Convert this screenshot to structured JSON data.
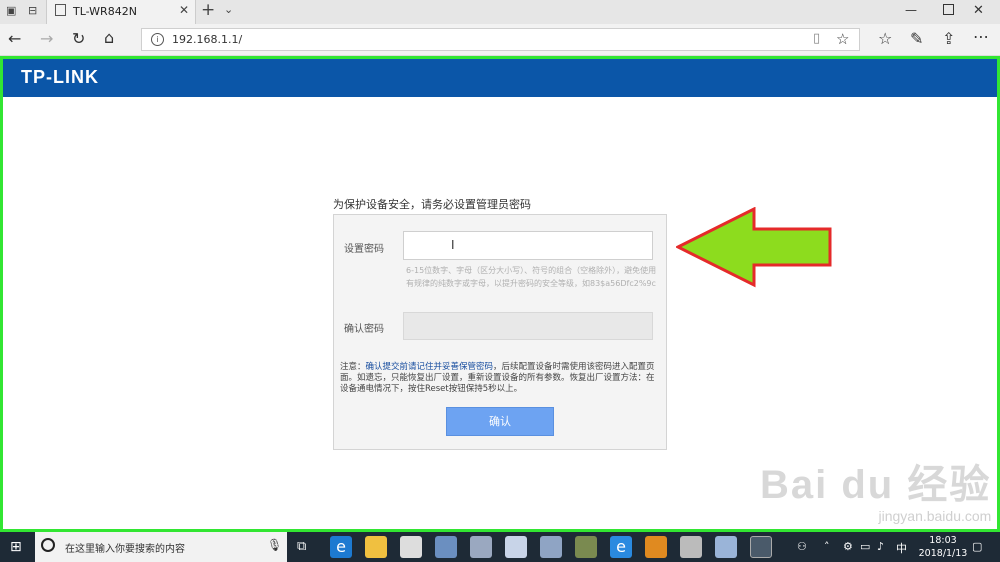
{
  "browser": {
    "tab_title": "TL-WR842N",
    "new_tab_symbol": "+",
    "url": "192.168.1.1/"
  },
  "router": {
    "logo": "TP-LINK",
    "notice": "为保护设备安全，请务必设置管理员密码",
    "set_password_label": "设置密码",
    "password_hint": "6-15位数字、字母（区分大小写）、符号的组合（空格除外），避免使用有规律的纯数字或字母，以提升密码的安全等级，如83$a56Dfc2%9c",
    "confirm_password_label": "确认密码",
    "note_prefix": "注意：",
    "note_highlight": "确认提交前请记住并妥善保管密码",
    "note_rest": "，后续配置设备时需使用该密码进入配置页面。如遗忘，只能恢复出厂设置，重新设置设备的所有参数。恢复出厂设置方法：在设备通电情况下，按住Reset按钮保持5秒以上。",
    "confirm_button": "确认"
  },
  "taskbar": {
    "search_placeholder": "在这里输入你要搜索的内容",
    "time": "18:03",
    "date": "2018/1/13",
    "ime": "中"
  },
  "watermark": {
    "brand": "Bai du 经验",
    "url": "jingyan.baidu.com"
  },
  "colors": {
    "header_blue": "#0b56a8",
    "highlight_border": "#32e632",
    "arrow_fill": "#8ddc1e",
    "arrow_stroke": "#e52a2a",
    "button_blue": "#6da3f2"
  }
}
